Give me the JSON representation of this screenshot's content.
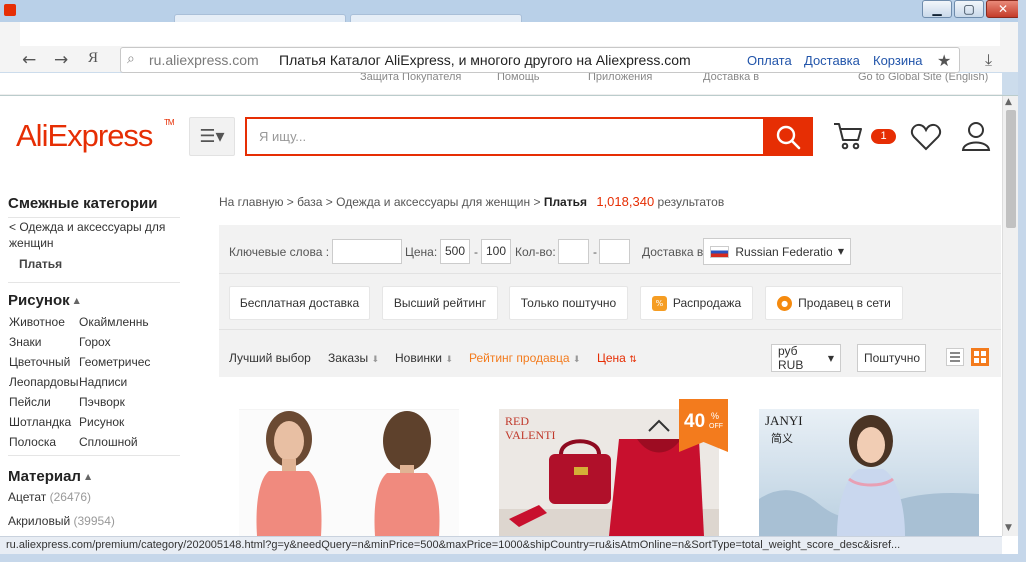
{
  "browser": {
    "address_url": "ru.aliexpress.com",
    "page_title": "Платья Каталог AliExpress, и многого другого на Aliexpress.com",
    "header_links": [
      "Оплата",
      "Доставка",
      "Корзина"
    ],
    "topstrip": [
      "Защита Покупателя",
      "Помощь",
      "Приложения",
      "Доставка в",
      "Go to Global Site (English)"
    ],
    "status_url": "ru.aliexpress.com/premium/category/202005148.html?g=y&needQuery=n&minPrice=500&maxPrice=1000&shipCountry=ru&isAtmOnline=n&SortType=total_weight_score_desc&isref..."
  },
  "header": {
    "logo_text": "AliExpress",
    "logo_tm": "TM",
    "search_placeholder": "Я ищу...",
    "cart_count": "1"
  },
  "sidebar": {
    "related_title": "Смежные категории",
    "parent_category": "< Одежда и аксессуары для женщин",
    "current_category": "Платья",
    "pattern_title": "Рисунок",
    "pattern_items": [
      "Животное",
      "Окаймленнь",
      "Знаки",
      "Горох",
      "Цветочный",
      "Геометричес",
      "Леопардовы",
      "Надписи",
      "Пейсли",
      "Пэчворк",
      "Шотландка",
      "Рисунок",
      "Полоска",
      "Сплошной"
    ],
    "material_title": "Материал",
    "material_items": [
      {
        "name": "Ацетат",
        "count": "(26476)"
      },
      {
        "name": "Акриловый",
        "count": "(39954)"
      }
    ]
  },
  "breadcrumb": {
    "items": [
      "На главную",
      "база",
      "Одежда и аксессуары для женщин"
    ],
    "current": "Платья",
    "result_count": "1,018,340",
    "results_label": "результатов"
  },
  "filters": {
    "keywords_label": "Ключевые слова :",
    "price_label": "Цена:",
    "price_min": "500",
    "price_max": "100",
    "qty_label": "Кол-во:",
    "ship_label": "Доставка в",
    "ship_country": "Russian Federatio",
    "chips": [
      "Бесплатная доставка",
      "Высший рейтинг",
      "Только поштучно",
      "Распродажа",
      "Продавец в сети"
    ],
    "sort_options": [
      "Лучший выбор",
      "Заказы",
      "Новинки",
      "Рейтинг продавца",
      "Цена"
    ],
    "currency": "руб RUB",
    "view_type": "Поштучно"
  },
  "products": {
    "discount_percent": "40",
    "discount_off": "OFF",
    "brand_1": "JANYI",
    "brand_2": "简义"
  },
  "colors": {
    "brand_red": "#e62e04",
    "sort_orange": "#f37b1d",
    "filter_bg": "#f2f2f2"
  }
}
